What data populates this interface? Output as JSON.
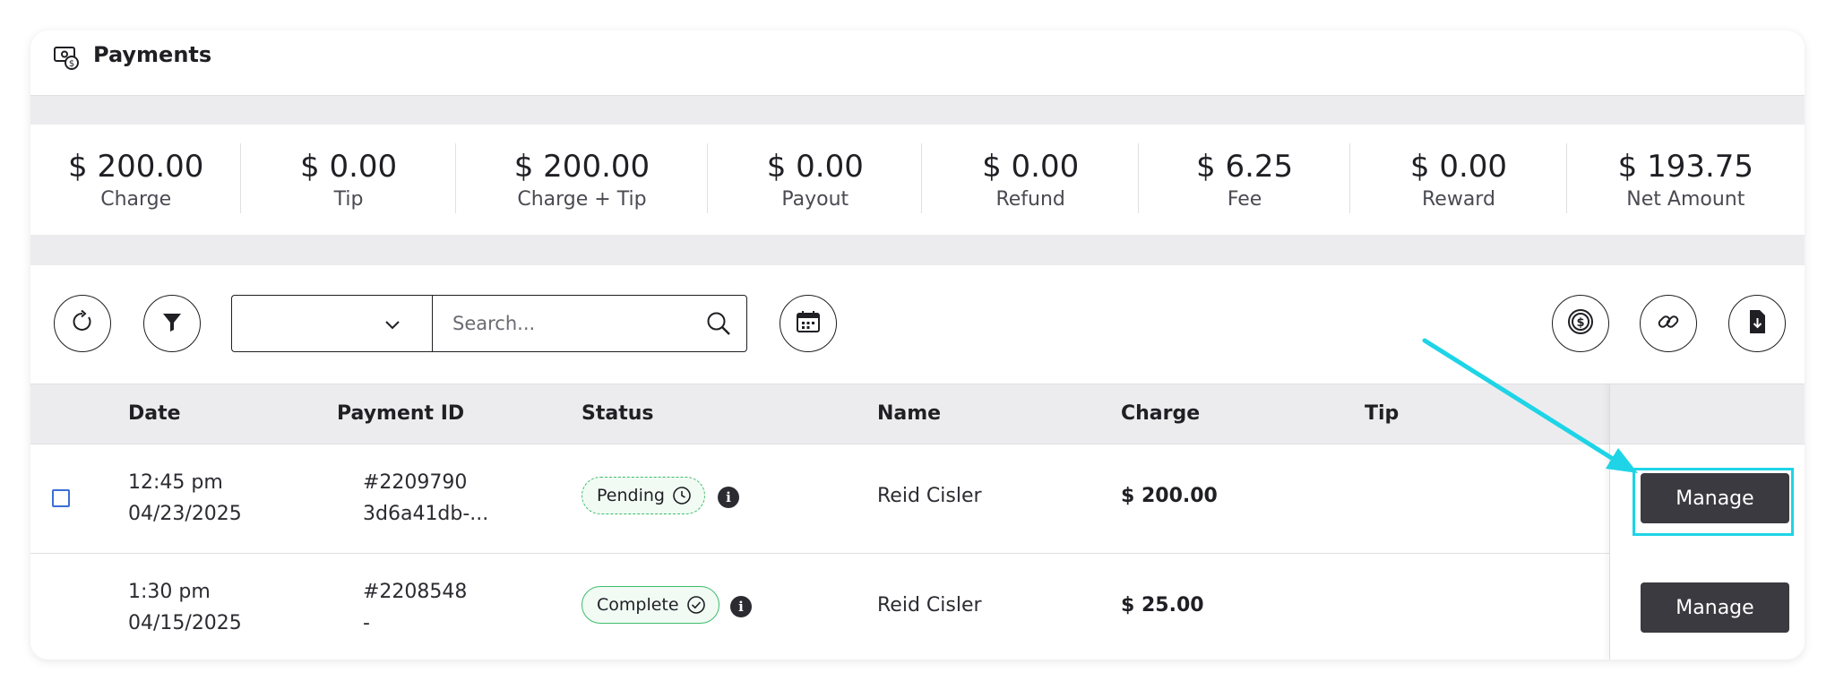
{
  "header": {
    "title": "Payments",
    "icon": "money-icon"
  },
  "summary": [
    {
      "value": "$ 200.00",
      "label": "Charge"
    },
    {
      "value": "$ 0.00",
      "label": "Tip"
    },
    {
      "value": "$ 200.00",
      "label": "Charge + Tip"
    },
    {
      "value": "$ 0.00",
      "label": "Payout"
    },
    {
      "value": "$ 0.00",
      "label": "Refund"
    },
    {
      "value": "$ 6.25",
      "label": "Fee"
    },
    {
      "value": "$ 0.00",
      "label": "Reward"
    },
    {
      "value": "$ 193.75",
      "label": "Net Amount"
    }
  ],
  "toolbar": {
    "select_value": "",
    "search_placeholder": "Search...",
    "icons": [
      "refresh-icon",
      "filter-icon",
      "chevron-down-icon",
      "search-icon",
      "calendar-icon",
      "dollar-icon",
      "link-icon",
      "download-file-icon"
    ]
  },
  "table": {
    "headers": {
      "date": "Date",
      "payment_id": "Payment ID",
      "status": "Status",
      "name": "Name",
      "charge": "Charge",
      "tip": "Tip"
    },
    "rows": [
      {
        "time": "12:45 pm",
        "date": "04/23/2025",
        "payment_id": "#2209790",
        "payment_ref": "3d6a41db-...",
        "status": "Pending",
        "name": "Reid Cisler",
        "charge": "$ 200.00",
        "action": "Manage"
      },
      {
        "time": "1:30 pm",
        "date": "04/15/2025",
        "payment_id": "#2208548",
        "payment_ref": "-",
        "status": "Complete",
        "name": "Reid Cisler",
        "charge": "$ 25.00",
        "action": "Manage"
      }
    ]
  },
  "colors": {
    "annotation": "#1ed4e6",
    "status_green": "#3dbd6b",
    "button_dark": "#3a3a40"
  }
}
